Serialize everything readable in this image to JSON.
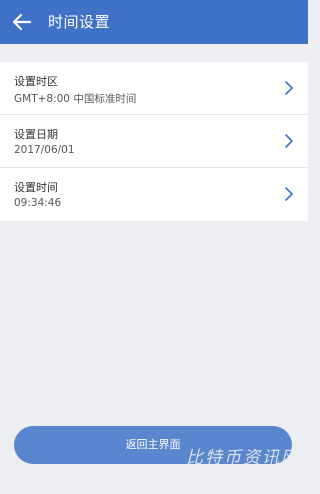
{
  "header": {
    "title": "时间设置",
    "back_icon": "arrow-left-icon",
    "background": "#3f72c6"
  },
  "settings": [
    {
      "label": "设置时区",
      "value": "GMT+8:00  中国标准时间",
      "icon": "chevron-right-icon"
    },
    {
      "label": "设置日期",
      "value": "2017/06/01",
      "icon": "chevron-right-icon"
    },
    {
      "label": "设置时间",
      "value": "09:34:46",
      "icon": "chevron-right-icon"
    }
  ],
  "footer": {
    "button_label": "返回主界面",
    "button_color": "#5a86cf"
  },
  "watermark": {
    "text": "比特币资讯网",
    "url": "www.bitcoin86.com"
  }
}
